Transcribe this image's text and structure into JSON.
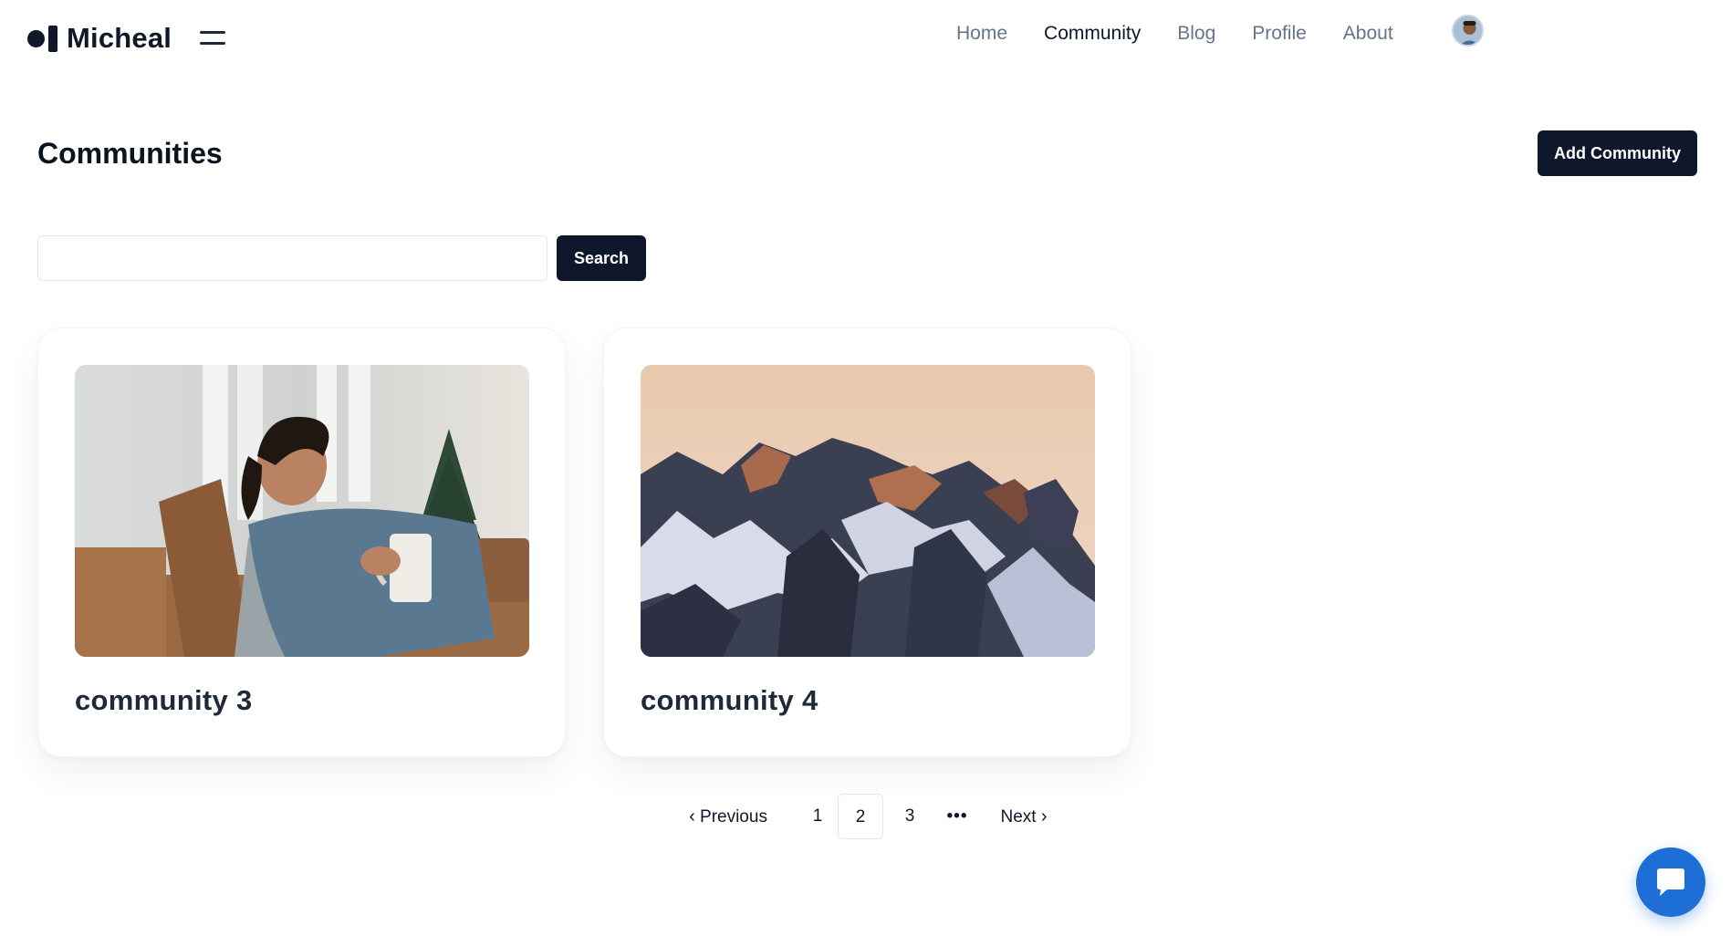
{
  "header": {
    "brand": "Micheal",
    "nav": [
      {
        "label": "Home",
        "active": false
      },
      {
        "label": "Community",
        "active": true
      },
      {
        "label": "Blog",
        "active": false
      },
      {
        "label": "Profile",
        "active": false
      },
      {
        "label": "About",
        "active": false
      }
    ]
  },
  "main": {
    "title": "Communities",
    "add_button": "Add Community",
    "search": {
      "value": "",
      "placeholder": "",
      "button": "Search"
    },
    "cards": [
      {
        "title": "community 3",
        "image": "woman-with-baby-and-mug-photo"
      },
      {
        "title": "community 4",
        "image": "snowy-mountain-peaks-photo"
      }
    ]
  },
  "pagination": {
    "previous": "Previous",
    "pages": [
      "1",
      "2",
      "3"
    ],
    "current": "2",
    "ellipsis": "•••",
    "next": "Next"
  },
  "icons": {
    "menu": "hamburger-menu-icon",
    "chat": "chat-bubble-icon",
    "prev": "chevron-left-icon",
    "next": "chevron-right-icon"
  },
  "colors": {
    "primary": "#0f172a",
    "nav_inactive": "#64748b",
    "chat_fab": "#1d6fd6"
  }
}
